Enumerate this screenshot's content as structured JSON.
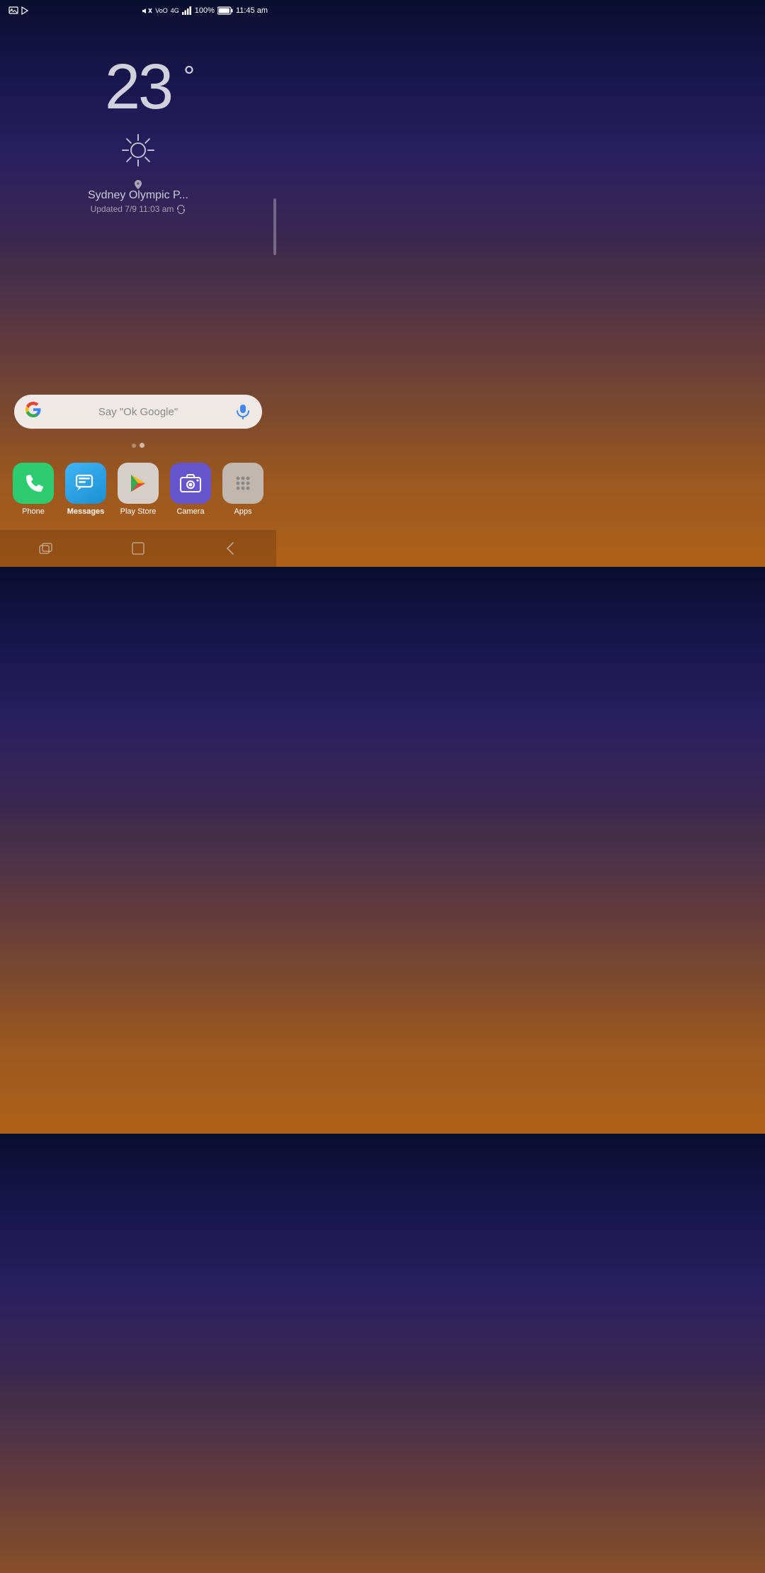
{
  "statusBar": {
    "time": "11:45 am",
    "battery": "100%",
    "icons": {
      "left": [
        "image-icon",
        "play-icon"
      ],
      "right": [
        "mute-icon",
        "voo-icon",
        "4g-icon",
        "signal-icon",
        "battery-icon"
      ]
    }
  },
  "weather": {
    "temperature": "23",
    "unit": "°",
    "condition": "sunny",
    "location": "Sydney Olympic P...",
    "updated": "Updated 7/9 11:03 am"
  },
  "searchBar": {
    "googleLetter": "G",
    "placeholder": "Say \"Ok Google\""
  },
  "dock": {
    "items": [
      {
        "id": "phone",
        "label": "Phone",
        "active": false
      },
      {
        "id": "messages",
        "label": "Messages",
        "active": true
      },
      {
        "id": "playstore",
        "label": "Play Store",
        "active": false
      },
      {
        "id": "camera",
        "label": "Camera",
        "active": false
      },
      {
        "id": "apps",
        "label": "Apps",
        "active": false
      }
    ]
  },
  "navigation": {
    "back": "‹",
    "home": "□",
    "recents": "⌐"
  }
}
